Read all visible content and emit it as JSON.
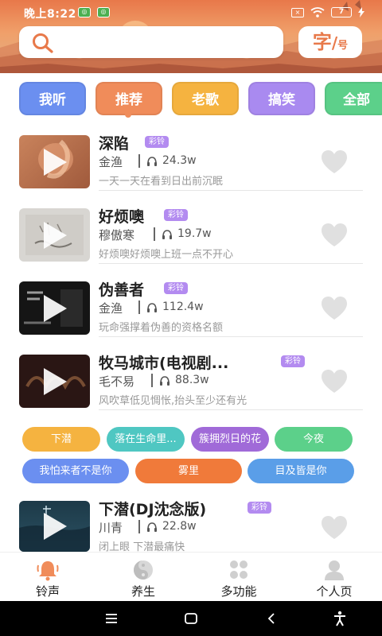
{
  "status_bar": {
    "time": "晚上8:22",
    "battery": "7"
  },
  "header": {
    "search_placeholder": "",
    "font_button": {
      "main": "字",
      "sub": "号"
    }
  },
  "tabs": [
    {
      "label": "我听",
      "color": "#6b8ff0"
    },
    {
      "label": "推荐",
      "color": "#f08c5a"
    },
    {
      "label": "老歌",
      "color": "#f5b340"
    },
    {
      "label": "搞笑",
      "color": "#a98af0"
    },
    {
      "label": "全部",
      "color": "#5cd08a"
    }
  ],
  "songs": [
    {
      "title": "深陷",
      "badge": "彩铃",
      "artist": "金渔",
      "plays": "24.3w",
      "lyric": "一天一天在看到日出前沉眠"
    },
    {
      "title": "好烦噢",
      "badge": "彩铃",
      "artist": "穆傲寒",
      "plays": "19.7w",
      "lyric": "好烦噢好烦噢上班一点不开心"
    },
    {
      "title": "伪善者",
      "badge": "彩铃",
      "artist": "金渔",
      "plays": "112.4w",
      "lyric": "玩命强撑着伪善的资格名额"
    },
    {
      "title": "牧马城市(电视剧...",
      "badge": "彩铃",
      "artist": "毛不易",
      "plays": "88.3w",
      "lyric": "风吹草低见惆怅,抬头至少还有光"
    },
    {
      "title": "下潜(DJ沈念版)",
      "badge": "彩铃",
      "artist": "川青",
      "plays": "22.8w",
      "lyric": "闭上眼 下潜最痛快"
    }
  ],
  "tags": [
    {
      "label": "下潜",
      "color": "#f5b340"
    },
    {
      "label": "落在生命里...",
      "color": "#4fc7c2"
    },
    {
      "label": "簇拥烈日的花",
      "color": "#a06ad8"
    },
    {
      "label": "今夜",
      "color": "#5cd08a"
    },
    {
      "label": "我怕来者不是你",
      "color": "#6b8ff0"
    },
    {
      "label": "雾里",
      "color": "#f07a3a"
    },
    {
      "label": "目及皆是你",
      "color": "#5a9ee8"
    }
  ],
  "bottom_nav": [
    {
      "label": "铃声",
      "icon": "bell-icon",
      "active": true
    },
    {
      "label": "养生",
      "icon": "yin-yang-icon"
    },
    {
      "label": "多功能",
      "icon": "grid-icon"
    },
    {
      "label": "个人页",
      "icon": "person-icon"
    }
  ],
  "colors": {
    "accent": "#f08c5a",
    "badge": "#b38bf0",
    "heart": "#e0e0e0"
  }
}
